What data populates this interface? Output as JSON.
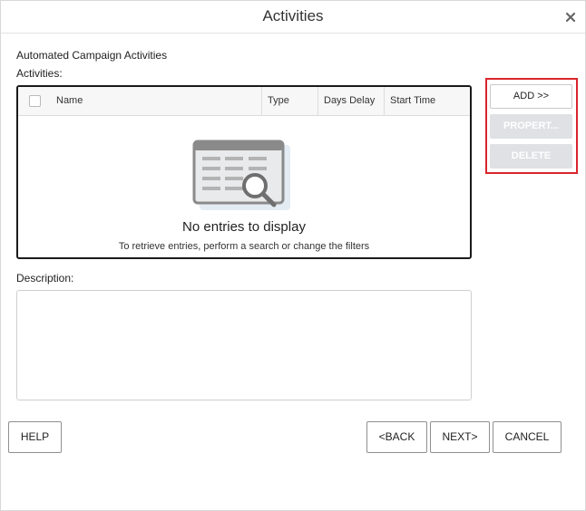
{
  "dialog": {
    "title": "Activities"
  },
  "section": {
    "heading": "Automated Campaign Activities",
    "activities_label": "Activities:"
  },
  "grid": {
    "columns": [
      "Name",
      "Type",
      "Days Delay",
      "Start Time"
    ],
    "rows": [],
    "empty_title": "No entries to display",
    "empty_subtitle": "To retrieve entries, perform a search or change the filters"
  },
  "side_buttons": {
    "add": "ADD >>",
    "properties": "PROPERT...",
    "delete": "DELETE"
  },
  "description": {
    "label": "Description:",
    "value": ""
  },
  "footer": {
    "help": "HELP",
    "back": "<BACK",
    "next": "NEXT>",
    "cancel": "CANCEL"
  },
  "colors": {
    "highlight": "#d9252c",
    "disabled_button": "#dfe1e4"
  }
}
